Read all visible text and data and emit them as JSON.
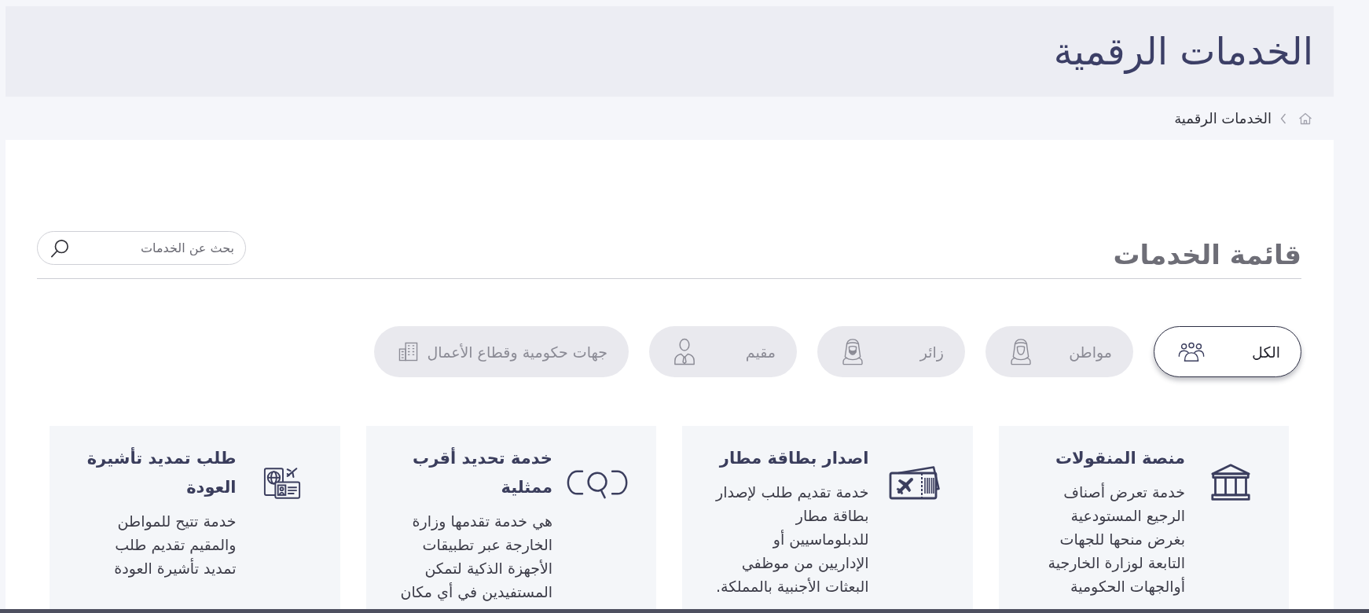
{
  "header": {
    "title": "الخدمات الرقمية"
  },
  "breadcrumb": {
    "items": [
      "الخدمات الرقمية"
    ]
  },
  "services": {
    "title": "قائمة الخدمات",
    "search": {
      "placeholder": "بحث عن الخدمات"
    },
    "filters": [
      {
        "label": "الكل",
        "kind": "all",
        "selected": true
      },
      {
        "label": "مواطن",
        "kind": "citizen",
        "selected": false
      },
      {
        "label": "زائر",
        "kind": "visitor",
        "selected": false
      },
      {
        "label": "مقيم",
        "kind": "resident",
        "selected": false
      },
      {
        "label": "جهات حكومية وقطاع الأعمال",
        "kind": "business",
        "selected": false
      }
    ],
    "cards": [
      {
        "kind": "warehouse",
        "title": [
          "منصة المنقولات"
        ],
        "description": [
          "خدمة تعرض أصناف",
          "الرجيع المستودعية",
          "بغرض منحها للجهات",
          "التابعة لوزارة الخارجية",
          "أوالجهات الحكومية"
        ]
      },
      {
        "kind": "airport",
        "title": [
          "اصدار بطاقة مطار"
        ],
        "description": [
          "خدمة تقديم طلب لإصدار",
          "بطاقة مطار",
          "للدبلوماسيين أو",
          "الإداريين من موظفي",
          "البعثات الأجنبية بالمملكة."
        ]
      },
      {
        "kind": "locator",
        "title": [
          "خدمة تحديد أقرب",
          "ممثلية"
        ],
        "description": [
          "هي خدمة تقدمها وزارة",
          "الخارجة عبر تطبيقات",
          "الأجهزة الذكية لتمكن",
          "المستفيدين في أي مكان"
        ]
      },
      {
        "kind": "visa",
        "title": [
          "طلب تمديد تأشيرة",
          "العودة"
        ],
        "description": [
          "خدمة تتيح للمواطن",
          "والمقيم تقديم طلب",
          "تمديد تأشيرة العودة"
        ]
      }
    ]
  }
}
